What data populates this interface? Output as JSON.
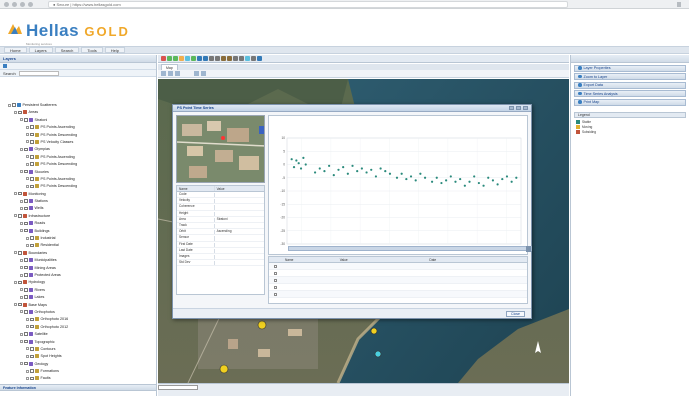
{
  "browser": {
    "url": "● Secure | https://www.hellasgold.com",
    "nav_icons": [
      "back-icon",
      "forward-icon",
      "reload-icon",
      "home-icon"
    ]
  },
  "header": {
    "logo_main": "Hellas",
    "logo_accent": "GOLD",
    "logo_sub": "Monitoring services",
    "right_text": ""
  },
  "menu": {
    "items": [
      "Home",
      "Layers",
      "Search",
      "Tools",
      "Help"
    ]
  },
  "left_panel": {
    "title": "Layers",
    "strip1_label": "",
    "strip2_label": "Search",
    "tree": [
      {
        "level": 1,
        "label": "Persistent Scatterers"
      },
      {
        "level": 2,
        "label": "Areas"
      },
      {
        "level": 3,
        "label": "Stratoni"
      },
      {
        "level": 4,
        "label": "PS Points Ascending"
      },
      {
        "level": 4,
        "label": "PS Points Descending"
      },
      {
        "level": 4,
        "label": "PS Velocity Classes"
      },
      {
        "level": 3,
        "label": "Olympias"
      },
      {
        "level": 4,
        "label": "PS Points Ascending"
      },
      {
        "level": 4,
        "label": "PS Points Descending"
      },
      {
        "level": 3,
        "label": "Skouries"
      },
      {
        "level": 4,
        "label": "PS Points Ascending"
      },
      {
        "level": 4,
        "label": "PS Points Descending"
      },
      {
        "level": 2,
        "label": "Monitoring"
      },
      {
        "level": 3,
        "label": "Stations"
      },
      {
        "level": 3,
        "label": "Wells"
      },
      {
        "level": 2,
        "label": "Infrastructure"
      },
      {
        "level": 3,
        "label": "Roads"
      },
      {
        "level": 3,
        "label": "Buildings"
      },
      {
        "level": 4,
        "label": "Industrial"
      },
      {
        "level": 4,
        "label": "Residential"
      },
      {
        "level": 2,
        "label": "Boundaries"
      },
      {
        "level": 3,
        "label": "Municipalities"
      },
      {
        "level": 3,
        "label": "Mining Areas"
      },
      {
        "level": 3,
        "label": "Protected Areas"
      },
      {
        "level": 2,
        "label": "Hydrology"
      },
      {
        "level": 3,
        "label": "Rivers"
      },
      {
        "level": 3,
        "label": "Lakes"
      },
      {
        "level": 2,
        "label": "Base Maps"
      },
      {
        "level": 3,
        "label": "Orthophotos"
      },
      {
        "level": 4,
        "label": "Orthophoto 2016"
      },
      {
        "level": 4,
        "label": "Orthophoto 2012"
      },
      {
        "level": 3,
        "label": "Satellite"
      },
      {
        "level": 3,
        "label": "Topographic"
      },
      {
        "level": 4,
        "label": "Contours"
      },
      {
        "level": 4,
        "label": "Spot Heights"
      },
      {
        "level": 3,
        "label": "Geology"
      },
      {
        "level": 4,
        "label": "Formations"
      },
      {
        "level": 4,
        "label": "Faults"
      }
    ],
    "bottom_title": "Feature Information"
  },
  "map": {
    "tab_label": "Map",
    "tools_label": "",
    "status_coords": "",
    "toolbar_text": ""
  },
  "dialog": {
    "title": "PS Point Time Series",
    "attr_header": [
      "Name",
      "Value"
    ],
    "attributes": [
      [
        "Code",
        ""
      ],
      [
        "Velocity",
        ""
      ],
      [
        "Coherence",
        ""
      ],
      [
        "Height",
        ""
      ],
      [
        "Area",
        "Stratoni"
      ],
      [
        "Track",
        ""
      ],
      [
        "Orbit",
        "Ascending"
      ],
      [
        "Sensor",
        ""
      ],
      [
        "First Date",
        ""
      ],
      [
        "Last Date",
        ""
      ],
      [
        "Images",
        ""
      ],
      [
        "Std Dev",
        ""
      ]
    ],
    "grid_header": [
      "",
      "Name",
      "Value",
      "Date"
    ],
    "grid_rows": [
      [
        "",
        "",
        "",
        ""
      ],
      [
        "",
        "",
        "",
        ""
      ],
      [
        "",
        "",
        "",
        ""
      ],
      [
        "",
        "",
        "",
        ""
      ],
      [
        "",
        "",
        "",
        ""
      ]
    ],
    "footer_button": "Close"
  },
  "chart_data": {
    "type": "scatter",
    "title": "",
    "subtitle": "",
    "xlabel": "",
    "ylabel": "",
    "x_ticks": [
      "Jun 2015",
      "Jan 2016",
      "Apr 2016",
      "Jul 2016",
      "Oct 2016",
      "Jan 2017",
      "Apr 2017",
      "Jul 2017"
    ],
    "y_ticks": [
      "10",
      "5",
      "0",
      "-5",
      "-10",
      "-15",
      "-20",
      "-25",
      "-30"
    ],
    "ylim": [
      -30,
      10
    ],
    "legend": "",
    "series_color": "#2a8a7c",
    "series": [
      {
        "name": "",
        "x": [
          0.02,
          0.03,
          0.04,
          0.05,
          0.06,
          0.07,
          0.08,
          0.12,
          0.14,
          0.16,
          0.18,
          0.2,
          0.22,
          0.24,
          0.26,
          0.28,
          0.3,
          0.32,
          0.34,
          0.36,
          0.38,
          0.4,
          0.42,
          0.44,
          0.47,
          0.49,
          0.51,
          0.53,
          0.55,
          0.57,
          0.59,
          0.62,
          0.64,
          0.66,
          0.68,
          0.7,
          0.72,
          0.74,
          0.76,
          0.78,
          0.8,
          0.82,
          0.84,
          0.86,
          0.88,
          0.9,
          0.92,
          0.94,
          0.96,
          0.98
        ],
        "y": [
          2.0,
          -1.0,
          1.5,
          0.5,
          -1.5,
          2.5,
          0.0,
          -3.0,
          -1.5,
          -2.5,
          -0.5,
          -4.0,
          -2.0,
          -1.0,
          -3.5,
          -0.5,
          -2.5,
          -1.5,
          -3.0,
          -2.0,
          -4.5,
          -1.5,
          -2.5,
          -3.5,
          -5.0,
          -3.5,
          -5.5,
          -4.5,
          -6.0,
          -3.5,
          -5.0,
          -6.5,
          -5.0,
          -7.0,
          -6.0,
          -4.5,
          -6.5,
          -5.5,
          -8.0,
          -6.5,
          -4.5,
          -7.0,
          -8.0,
          -5.0,
          -6.0,
          -7.5,
          -5.5,
          -4.5,
          -6.5,
          -5.0
        ]
      }
    ]
  },
  "right_panel": {
    "buttons": [
      "Layer Properties",
      "Zoom to Layer",
      "Export Data",
      "Time Series Analysis",
      "Print Map"
    ],
    "legend_title_a": "Legend",
    "legend_title_b": "",
    "legend_rows": [
      {
        "label": "Stable",
        "value": ""
      },
      {
        "label": "Moving",
        "value": ""
      },
      {
        "label": "Subsiding",
        "value": ""
      }
    ]
  }
}
